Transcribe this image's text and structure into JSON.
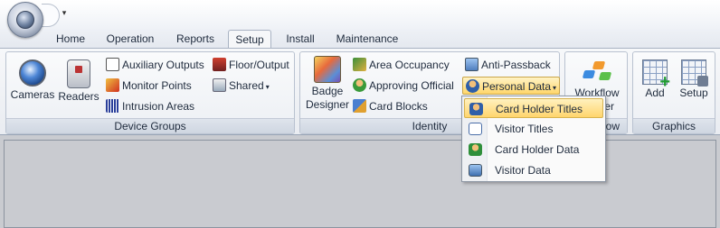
{
  "quick_access": {
    "dropdown_glyph": "▾"
  },
  "tabs": [
    {
      "label": "Home"
    },
    {
      "label": "Operation"
    },
    {
      "label": "Reports"
    },
    {
      "label": "Setup"
    },
    {
      "label": "Install"
    },
    {
      "label": "Maintenance"
    }
  ],
  "active_tab": "Setup",
  "groups": {
    "device_groups": {
      "label": "Device Groups",
      "cameras": "Cameras",
      "readers": "Readers",
      "auxiliary_outputs": "Auxiliary Outputs",
      "monitor_points": "Monitor Points",
      "intrusion_areas": "Intrusion Areas",
      "floor_output": "Floor/Output",
      "shared": "Shared"
    },
    "identity": {
      "label": "Identity",
      "badge_designer_line1": "Badge",
      "badge_designer_line2": "Designer",
      "area_occupancy": "Area Occupancy",
      "approving_official": "Approving Official",
      "card_blocks": "Card Blocks",
      "anti_passback": "Anti-Passback",
      "personal_data": "Personal Data"
    },
    "workflow": {
      "label_partial": "ow",
      "button_line1": "Workflow",
      "button_line2_partial": "er"
    },
    "graphics": {
      "label": "Graphics",
      "add": "Add",
      "setup": "Setup"
    }
  },
  "personal_data_menu": [
    {
      "label": "Card Holder Titles",
      "highlighted": true
    },
    {
      "label": "Visitor Titles",
      "highlighted": false
    },
    {
      "label": "Card Holder Data",
      "highlighted": false
    },
    {
      "label": "Visitor Data",
      "highlighted": false
    }
  ],
  "colors": {
    "ribbon_bg": "#eceff4",
    "highlight": "#ffd66b",
    "workspace": "#c9cbd0"
  }
}
